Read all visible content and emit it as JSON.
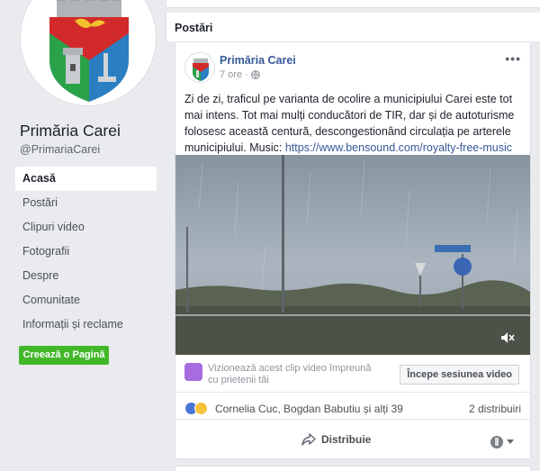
{
  "page": {
    "name": "Primăria Carei",
    "handle": "@PrimariaCarei"
  },
  "nav": {
    "items": [
      {
        "label": "Acasă",
        "active": true
      },
      {
        "label": "Postări",
        "active": false
      },
      {
        "label": "Clipuri video",
        "active": false
      },
      {
        "label": "Fotografii",
        "active": false
      },
      {
        "label": "Despre",
        "active": false
      },
      {
        "label": "Comunitate",
        "active": false
      },
      {
        "label": "Informații și reclame",
        "active": false
      }
    ],
    "create_page_label": "Creează o Pagină"
  },
  "section": {
    "title": "Postări"
  },
  "post": {
    "author": "Primăria Carei",
    "time": "7 ore",
    "time_separator": "·",
    "privacy_icon": "globe-icon",
    "more_label": "•••",
    "text": "Zi de zi, traficul pe varianta de ocolire a municipiului Carei este tot mai intens. Tot mai mulți conducători de TIR, dar și de autoturisme folosesc această centură, descongestionând circulația pe arterele municipiului. Music: ",
    "link": "https://www.bensound.com/royalty-free-music",
    "watch_together_text": "Vizionează acest clip video împreună cu prietenii tăi",
    "watch_together_button": "Începe sesiunea video",
    "reaction_names": "Cornelia Cuc, Bogdan Babutiu și alți 39",
    "shares": "2 distribuiri",
    "share_label": "Distribuie"
  },
  "colors": {
    "facebook_blue": "#365899",
    "green_button": "#42b72a",
    "watch_purple": "#a66ce0"
  }
}
